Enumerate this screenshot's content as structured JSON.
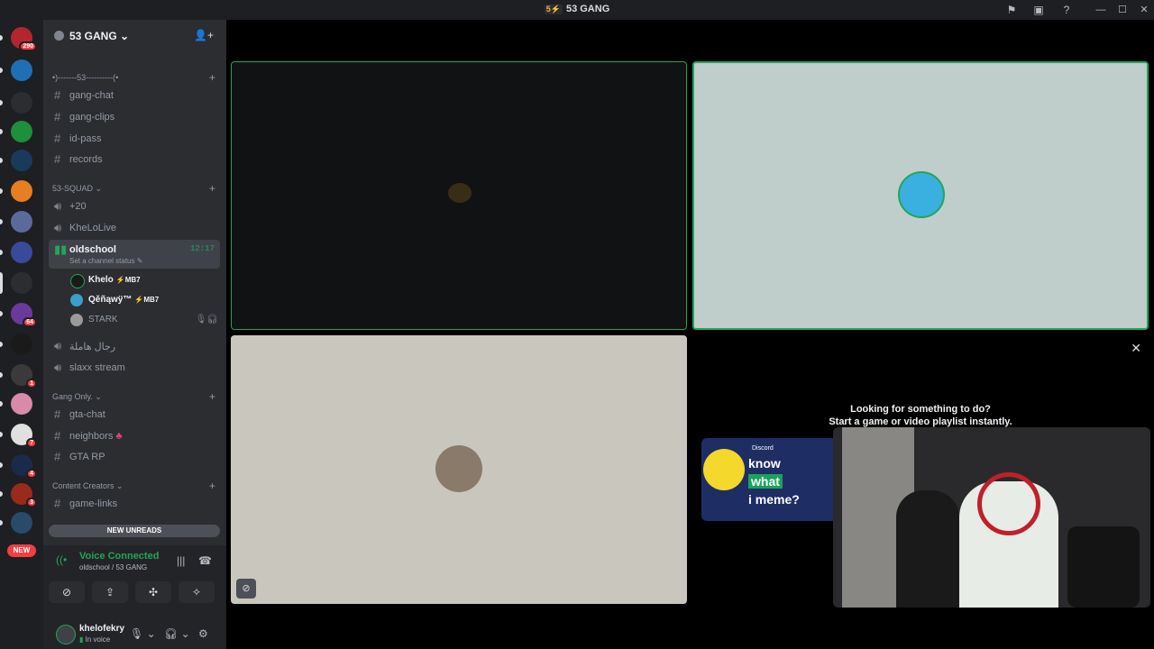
{
  "window": {
    "title": "53 GANG",
    "title_icon": "5⚡"
  },
  "guilds": [
    {
      "color": "#b3262e",
      "badge": "290"
    },
    {
      "color": "#1f6fb5",
      "badge": ""
    },
    {
      "color": "#2b2d31",
      "badge": ""
    },
    {
      "color": "#1e8f3a",
      "badge": ""
    },
    {
      "color": "#1a3a5c",
      "badge": ""
    },
    {
      "color": "#e67e22",
      "badge": ""
    },
    {
      "color": "#5a6a9a",
      "badge": ""
    },
    {
      "color": "#3a4a9a",
      "badge": ""
    },
    {
      "color": "#2b2d31",
      "badge": ""
    },
    {
      "color": "#6a3a9a",
      "badge": "64"
    },
    {
      "color": "#1a1a1a",
      "badge": ""
    },
    {
      "color": "#3a3a3a",
      "badge": "1"
    },
    {
      "color": "#d88aa8",
      "badge": ""
    },
    {
      "color": "#e0e0e0",
      "badge": "7"
    },
    {
      "color": "#1a2a4a",
      "badge": "4"
    },
    {
      "color": "#9a2a1a",
      "badge": "3"
    },
    {
      "color": "#2a4a6a",
      "badge": ""
    }
  ],
  "new_pill": "NEW",
  "server": {
    "name": "53 GANG"
  },
  "categories": {
    "cat1": "•)-------53----------(•",
    "cat2": "53-SQUAD",
    "cat3": "Gang Only.",
    "cat4": "Content Creators"
  },
  "channels": {
    "gang_chat": "gang-chat",
    "gang_clips": "gang-clips",
    "id_pass": "id-pass",
    "records": "records",
    "plus20": "+20",
    "khelolive": "KheLoLive",
    "oldschool": "oldschool",
    "oldschool_status": "Set a channel status",
    "oldschool_time": "12:17",
    "rigal": "رجال هاملة",
    "slaxx": "slaxx stream",
    "gta_chat": "gta-chat",
    "neighbors": "neighbors",
    "gta_rp": "GTA RP",
    "game_links": "game-links"
  },
  "voice_users": [
    {
      "name": "Khelo",
      "tag": "⚡MB7"
    },
    {
      "name": "Qěñąwÿ™",
      "tag": "⚡MB7"
    },
    {
      "name": "STARK",
      "tag": ""
    }
  ],
  "new_unreads": "NEW UNREADS",
  "voice": {
    "status": "Voice Connected",
    "location": "oldschool / 53 GANG"
  },
  "user": {
    "name": "khelofekry",
    "status": "In voice"
  },
  "activity": {
    "line1": "Looking for something to do?",
    "line2": "Start a game or video playlist instantly.",
    "game_brand": "Discord",
    "game_w1": "know",
    "game_w2": "what",
    "game_w3": "i meme?"
  },
  "colors": {
    "accent_green": "#23a559",
    "badge_red": "#f23f43",
    "sidebar": "#2b2d31"
  }
}
